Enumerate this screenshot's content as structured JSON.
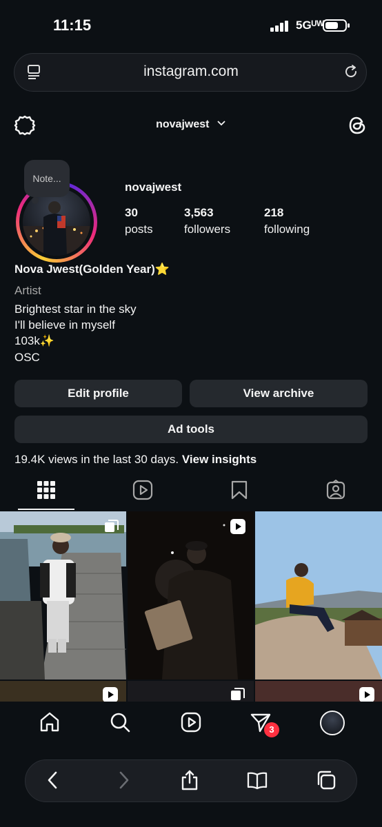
{
  "status_bar": {
    "time": "11:15",
    "network": "5Gᵁᵂ"
  },
  "browser": {
    "url": "instagram.com"
  },
  "header": {
    "username": "novajwest"
  },
  "profile": {
    "note": "Note...",
    "username": "novajwest",
    "stats": [
      {
        "value": "30",
        "label": "posts"
      },
      {
        "value": "3,563",
        "label": "followers"
      },
      {
        "value": "218",
        "label": "following"
      }
    ],
    "full_name": "Nova Jwest(Golden Year)⭐",
    "category": "Artist",
    "bio_lines": [
      "Brightest star in the sky",
      "I'll believe in myself",
      "103k✨",
      "OSC"
    ]
  },
  "buttons": {
    "edit_profile": "Edit profile",
    "view_archive": "View archive",
    "ad_tools": "Ad tools"
  },
  "insights": {
    "text": "19.4K views in the last 30 days.",
    "link": "View insights"
  },
  "bottom_nav": {
    "notification_count": "3"
  },
  "colors": {
    "background": "#0c1014",
    "button": "#25292e",
    "badge": "#ff3040"
  }
}
